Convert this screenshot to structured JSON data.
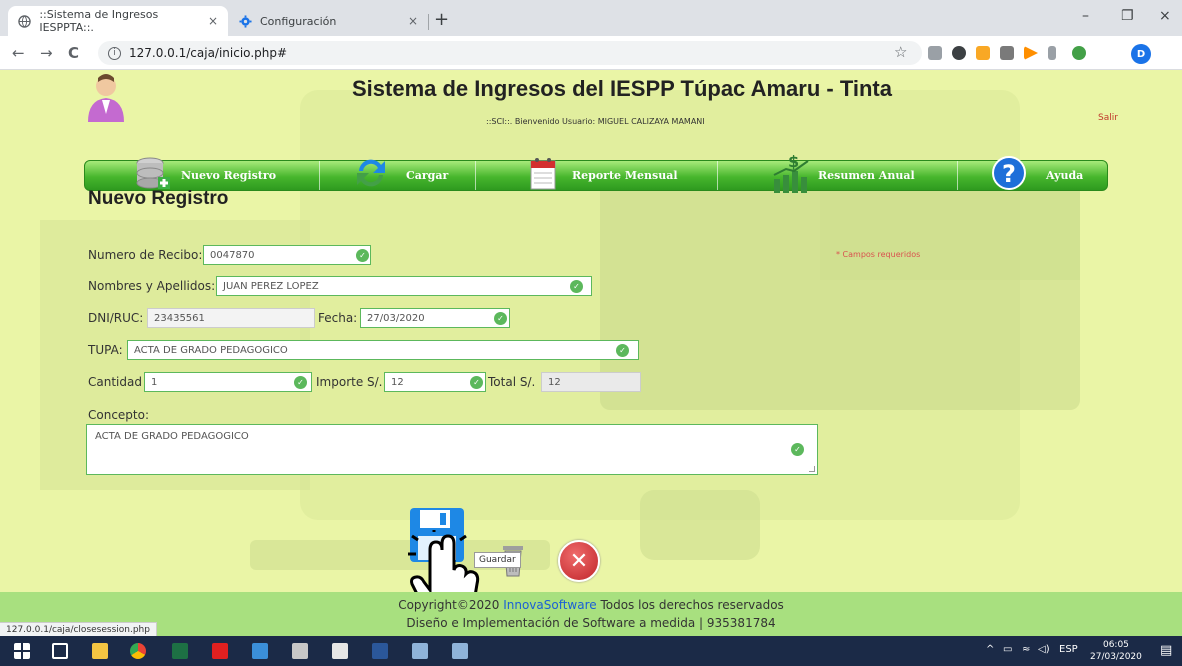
{
  "browser": {
    "tabs": [
      {
        "title": "::Sistema de Ingresos IESPPTA::.",
        "close": "×",
        "active": true
      },
      {
        "title": "Configuración",
        "close": "×",
        "active": false
      }
    ],
    "new_tab": "+",
    "window_controls": {
      "minimize": "–",
      "restore": "❐",
      "close": "×"
    },
    "nav": {
      "back": "←",
      "forward": "→",
      "reload": "C"
    },
    "url": "127.0.0.1/caja/inicio.php#",
    "profile_initial": "D"
  },
  "app": {
    "title": "Sistema de Ingresos del IESPP Túpac Amaru - Tinta",
    "welcome": "::SCI::. Bienvenido Usuario: MIGUEL CALIZAYA MAMANI",
    "logout": "Salir",
    "menu": [
      {
        "label": "Nuevo Registro",
        "icon": "database-add-icon"
      },
      {
        "label": "Cargar",
        "icon": "refresh-icon"
      },
      {
        "label": "Reporte Mensual",
        "icon": "calendar-icon"
      },
      {
        "label": "Resumen Anual",
        "icon": "chart-money-icon"
      },
      {
        "label": "Ayuda",
        "icon": "help-icon"
      }
    ]
  },
  "form": {
    "heading": "Nuevo Registro",
    "required_note": "* Campos requeridos",
    "recibo": {
      "label": "Numero de Recibo:",
      "value": "0047870"
    },
    "nombres": {
      "label": "Nombres y Apellidos:",
      "value": "JUAN PEREZ LOPEZ"
    },
    "dni": {
      "label": "DNI/RUC:",
      "value": "23435561"
    },
    "fecha": {
      "label": "Fecha:",
      "value": "27/03/2020"
    },
    "tupa": {
      "label": "TUPA:",
      "value": "ACTA DE GRADO PEDAGOGICO"
    },
    "cantidad": {
      "label": "Cantidad",
      "value": "1"
    },
    "importe": {
      "label": "Importe S/.",
      "value": "12"
    },
    "total": {
      "label": "Total S/.",
      "value": "12"
    },
    "concepto": {
      "label": "Concepto:",
      "value": "ACTA DE GRADO PEDAGOGICO"
    },
    "save_tooltip": "Guardar"
  },
  "footer": {
    "copyright_prefix": "Copyright©2020 ",
    "brand": "InnovaSoftware",
    "copyright_suffix": " Todos los derechos reservados",
    "line2": "Diseño e Implementación de Software a medida | 935381784"
  },
  "status_url": "127.0.0.1/caja/closesession.php",
  "taskbar": {
    "language": "ESP",
    "time": "06:05",
    "date": "27/03/2020"
  }
}
